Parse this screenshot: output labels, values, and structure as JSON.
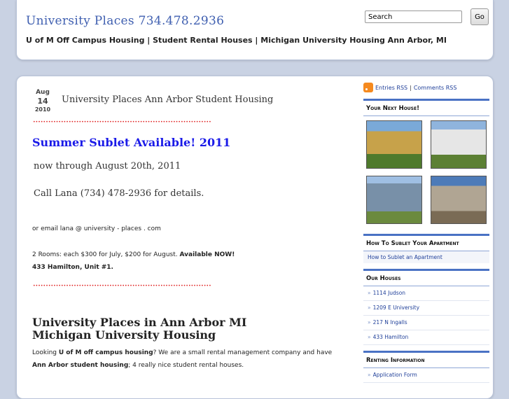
{
  "header": {
    "site_title": "University Places 734.478.2936",
    "tagline": "U of M Off Campus Housing | Student Rental Houses | Michigan University Housing Ann Arbor, MI",
    "search_placeholder": "Search",
    "go_label": "Go"
  },
  "post": {
    "date": {
      "month": "Aug",
      "day": "14",
      "year": "2010"
    },
    "title": "University Places Ann Arbor Student Housing",
    "divider": "••••••••••••••••••••••••••••••••••••••••••••••••••••••••••••••••••••••",
    "sublet_heading": "Summer Sublet Available! 2011",
    "line1": "now through August 20th, 2011",
    "line2": "Call Lana (734) 478-2936 for details.",
    "email_line": "or email lana @ university - places . com",
    "rooms_text": "2 Rooms: each $300 for July, $200 for August.",
    "rooms_bold": "Available NOW!",
    "address": "433 Hamilton, Unit #1.",
    "heading2_line1": "University Places in Ann Arbor MI",
    "heading2_line2": "Michigan University Housing",
    "para_a": "Looking ",
    "para_b": "U of M off campus housing",
    "para_c": "?  We are a small rental management company and have ",
    "para_d": "Ann Arbor student housing",
    "para_e": ";  4 really nice student rental houses."
  },
  "sidebar": {
    "entries_rss": "Entries RSS",
    "sep": "|",
    "comments_rss": "Comments RSS",
    "next_house_title": "Your Next House!",
    "sublet_title": "How To Sublet Your Apartment",
    "sublet_link": "How to Sublet an Apartment",
    "houses_title": "Our Houses",
    "houses": [
      "1114 Judson",
      "1209 E University",
      "217 N Ingalls",
      "433 Hamilton"
    ],
    "renting_title": "Renting Information",
    "renting_item": "Application Form"
  },
  "colors": {
    "accent": "#4a72c4",
    "title_blue": "#3f5fb0",
    "link": "#1f3f99",
    "sublet_blue": "#1a1ae8",
    "divider_red": "#e02020"
  }
}
